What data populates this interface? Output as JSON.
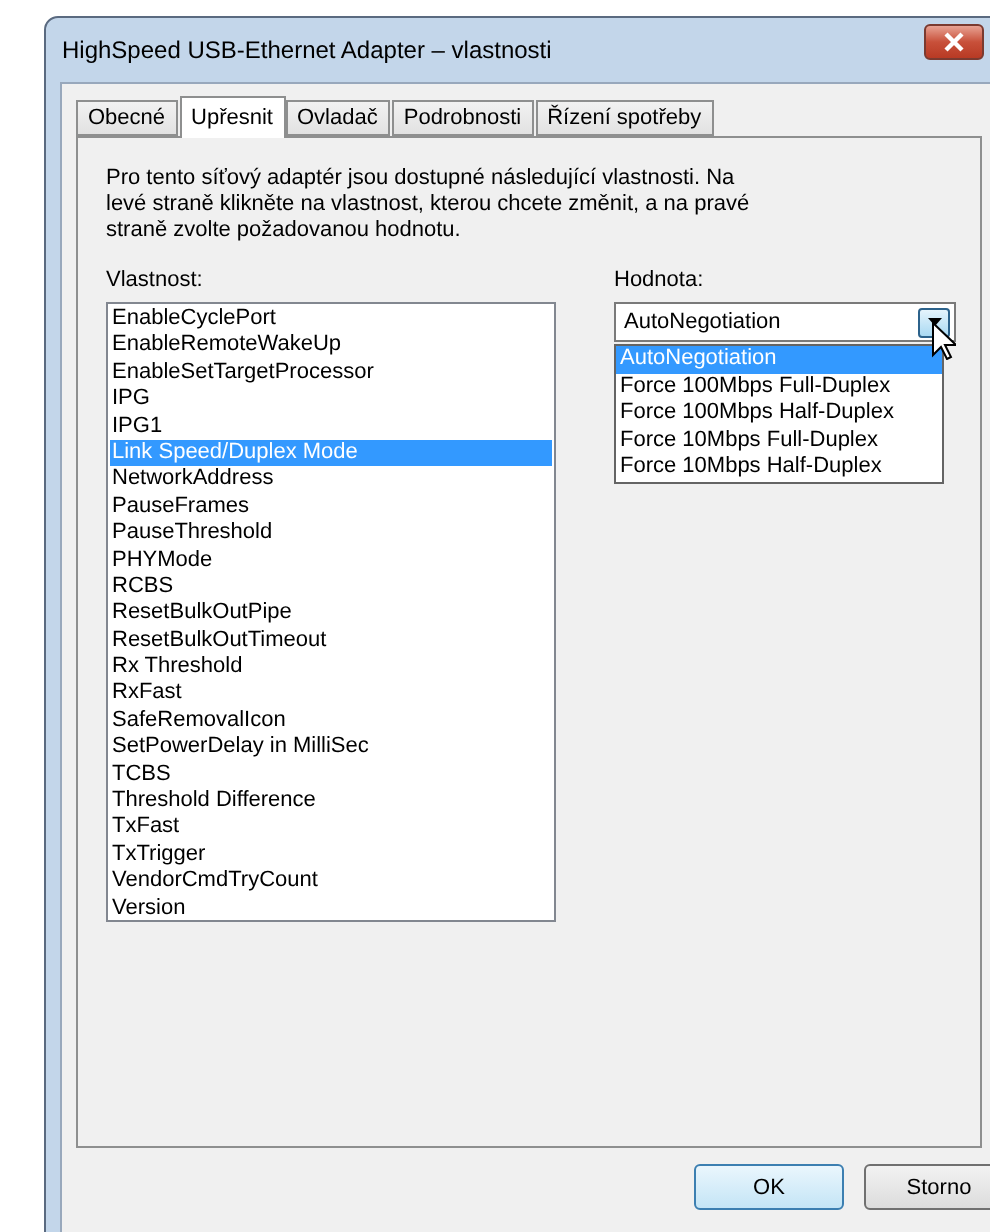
{
  "window": {
    "title": "HighSpeed USB-Ethernet Adapter – vlastnosti"
  },
  "tabs": [
    {
      "label": "Obecné",
      "selected": false
    },
    {
      "label": "Upřesnit",
      "selected": true
    },
    {
      "label": "Ovladač",
      "selected": false
    },
    {
      "label": "Podrobnosti",
      "selected": false
    },
    {
      "label": "Řízení spotřeby",
      "selected": false
    }
  ],
  "description": "Pro tento síťový adaptér jsou dostupné následující vlastnosti. Na levé straně klikněte na vlastnost, kterou chcete změnit, a na pravé straně zvolte požadovanou hodnotu.",
  "property_label": "Vlastnost:",
  "properties": [
    {
      "label": "EnableCyclePort",
      "selected": false
    },
    {
      "label": "EnableRemoteWakeUp",
      "selected": false
    },
    {
      "label": "EnableSetTargetProcessor",
      "selected": false
    },
    {
      "label": "IPG",
      "selected": false
    },
    {
      "label": "IPG1",
      "selected": false
    },
    {
      "label": "Link Speed/Duplex Mode",
      "selected": true
    },
    {
      "label": "NetworkAddress",
      "selected": false
    },
    {
      "label": "PauseFrames",
      "selected": false
    },
    {
      "label": "PauseThreshold",
      "selected": false
    },
    {
      "label": "PHYMode",
      "selected": false
    },
    {
      "label": "RCBS",
      "selected": false
    },
    {
      "label": "ResetBulkOutPipe",
      "selected": false
    },
    {
      "label": "ResetBulkOutTimeout",
      "selected": false
    },
    {
      "label": "Rx Threshold",
      "selected": false
    },
    {
      "label": "RxFast",
      "selected": false
    },
    {
      "label": "SafeRemovalIcon",
      "selected": false
    },
    {
      "label": "SetPowerDelay in MilliSec",
      "selected": false
    },
    {
      "label": "TCBS",
      "selected": false
    },
    {
      "label": "Threshold Difference",
      "selected": false
    },
    {
      "label": "TxFast",
      "selected": false
    },
    {
      "label": "TxTrigger",
      "selected": false
    },
    {
      "label": "VendorCmdTryCount",
      "selected": false
    },
    {
      "label": "Version",
      "selected": false
    }
  ],
  "value_label": "Hodnota:",
  "value": {
    "value": "AutoNegotiation",
    "expanded": true,
    "options": [
      {
        "label": "AutoNegotiation",
        "selected": true
      },
      {
        "label": "Force 100Mbps Full-Duplex",
        "selected": false
      },
      {
        "label": "Force 100Mbps Half-Duplex",
        "selected": false
      },
      {
        "label": "Force 10Mbps Full-Duplex",
        "selected": false
      },
      {
        "label": "Force 10Mbps Half-Duplex",
        "selected": false
      }
    ]
  },
  "buttons": [
    {
      "label": "OK",
      "kind": "default"
    },
    {
      "label": "Storno",
      "kind": "normal"
    }
  ]
}
